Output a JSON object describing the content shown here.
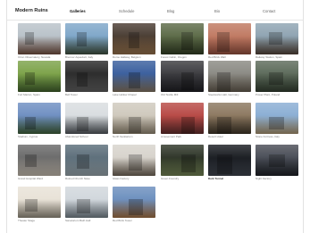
{
  "site": {
    "brand": "Modern Ruins",
    "nav": [
      {
        "label": "Galleries",
        "active": true
      },
      {
        "label": "Schedule",
        "active": false
      },
      {
        "label": "Blog",
        "active": false
      },
      {
        "label": "Bio",
        "active": false
      },
      {
        "label": "Contact",
        "active": false
      }
    ]
  },
  "gallery": {
    "rows": [
      [
        {
          "caption": "Orion Observatory, Nevada",
          "top": "#b9c2c9",
          "bottom": "#6b4a3c"
        },
        {
          "caption": "Brenner Aqueduct, Italy",
          "top": "#7fa7c9",
          "bottom": "#3b4a3a"
        },
        {
          "caption": "Dome Hallway, Belgium",
          "top": "#4a3d33",
          "bottom": "#8c6a47"
        },
        {
          "caption": "Forest Cabin, Oregon",
          "top": "#5d6b48",
          "bottom": "#2f3a22"
        },
        {
          "caption": "Red Brick Wall",
          "top": "#c07a63",
          "bottom": "#8a4b3b"
        },
        {
          "caption": "Railway Station, Spain",
          "top": "#8fa4b2",
          "bottom": "#4d3f35"
        }
      ],
      [
        {
          "caption": "Fort Marion, Spain",
          "top": "#7da34a",
          "bottom": "#3d5a2a"
        },
        {
          "caption": "Bell Tower",
          "top": "#2b2b2b",
          "bottom": "#5a5a5a"
        },
        {
          "caption": "Lake Hollow Chapel",
          "top": "#3a5f9e",
          "bottom": "#7c6e5c"
        },
        {
          "caption": "Old Textile Mill",
          "top": "#3c3c40",
          "bottom": "#1e1e22"
        },
        {
          "caption": "Steelworks Hall, Germany",
          "top": "#8b8a84",
          "bottom": "#5e564a"
        },
        {
          "caption": "Power Plant, Poland",
          "top": "#5d6b5b",
          "bottom": "#2f3a2d"
        }
      ],
      [
        {
          "caption": "Stadium, Cyprus",
          "top": "#6f8fc2",
          "bottom": "#3c5a36"
        },
        {
          "caption": "Abandoned School",
          "top": "#d9dde0",
          "bottom": "#4d5257"
        },
        {
          "caption": "North Sanitarium",
          "top": "#cfc9bd",
          "bottom": "#8a7f6c"
        },
        {
          "caption": "Amusement Park",
          "top": "#b84a46",
          "bottom": "#5b2b2a"
        },
        {
          "caption": "Desert Hotel",
          "top": "#8c7860",
          "bottom": "#3a3226"
        },
        {
          "caption": "Stone Fortress, Italy",
          "top": "#8aaed4",
          "bottom": "#9e8a6a"
        }
      ],
      [
        {
          "caption": "Grand Hospital Ward",
          "top": "#6a6a6a",
          "bottom": "#b8b0a4"
        },
        {
          "caption": "Ruined Church Nave",
          "top": "#5c6e7a",
          "bottom": "#8e9aa0"
        },
        {
          "caption": "Glass Factory",
          "top": "#d7d3cc",
          "bottom": "#6a5f52"
        },
        {
          "caption": "Green Foundry",
          "top": "#2e3528",
          "bottom": "#6b7a4e"
        },
        {
          "caption": "Dark Tunnel",
          "top": "#1a1d22",
          "bottom": "#3b4049"
        },
        {
          "caption": "Night Factory",
          "top": "#4a4e57",
          "bottom": "#1c1f24"
        }
      ],
      [
        {
          "caption": "Theater Stage",
          "top": "#e8e2d7",
          "bottom": "#8c8577"
        },
        {
          "caption": "Sanatorium Bath Hall",
          "top": "#d1d7dc",
          "bottom": "#6f7a82"
        },
        {
          "caption": "Red Brick Tower",
          "top": "#6c8fbe",
          "bottom": "#9a6a3f"
        }
      ]
    ]
  }
}
